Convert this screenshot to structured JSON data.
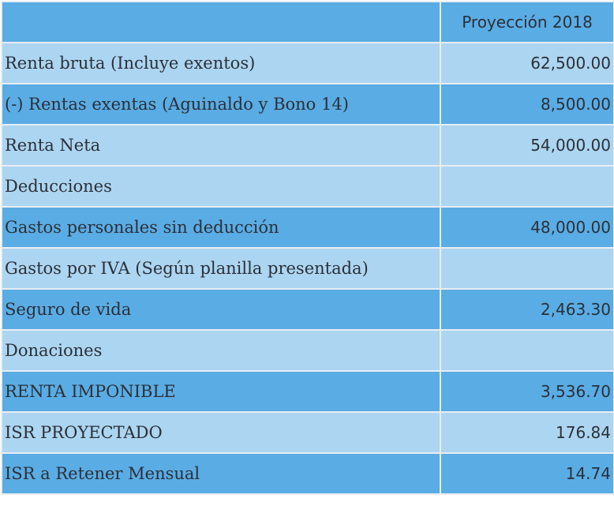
{
  "header": {
    "label": "",
    "value": "Proyección 2018"
  },
  "rows": [
    {
      "label": "Renta bruta (Incluye exentos)",
      "value": "62,500.00",
      "shade": "light"
    },
    {
      "label": "(-) Rentas exentas (Aguinaldo y Bono 14)",
      "value": "8,500.00",
      "shade": "dark"
    },
    {
      "label": "Renta Neta",
      "value": "54,000.00",
      "shade": "light"
    },
    {
      "label": "Deducciones",
      "value": "",
      "shade": "light"
    },
    {
      "label": "Gastos personales sin deducción",
      "value": "48,000.00",
      "shade": "dark"
    },
    {
      "label": "Gastos por IVA (Según planilla presentada)",
      "value": "",
      "shade": "light"
    },
    {
      "label": "Seguro de vida",
      "value": "2,463.30",
      "shade": "dark"
    },
    {
      "label": "Donaciones",
      "value": "",
      "shade": "light"
    },
    {
      "label": "RENTA IMPONIBLE",
      "value": "3,536.70",
      "shade": "dark"
    },
    {
      "label": "ISR PROYECTADO",
      "value": "176.84",
      "shade": "light"
    },
    {
      "label": "ISR a Retener Mensual",
      "value": "14.74",
      "shade": "dark"
    }
  ],
  "colors": {
    "dark_row": "#5aace4",
    "light_row": "#acd5f1",
    "border": "#e8edf2",
    "text": "#2b3038"
  }
}
